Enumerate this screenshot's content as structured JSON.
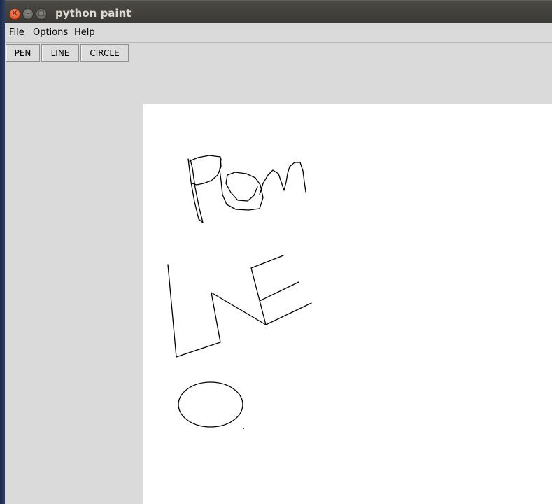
{
  "window": {
    "title": "python paint",
    "controls": [
      "close-icon",
      "minimize-icon",
      "maximize-icon"
    ]
  },
  "menu": {
    "items": [
      "File",
      "Options",
      "Help"
    ]
  },
  "toolbar": {
    "buttons": [
      "PEN",
      "LINE",
      "CIRCLE"
    ]
  },
  "canvas": {
    "background": "#ffffff",
    "stroke_color": "#000000",
    "drawings": [
      "freehand pen scribble",
      "polyline",
      "ellipse"
    ]
  }
}
